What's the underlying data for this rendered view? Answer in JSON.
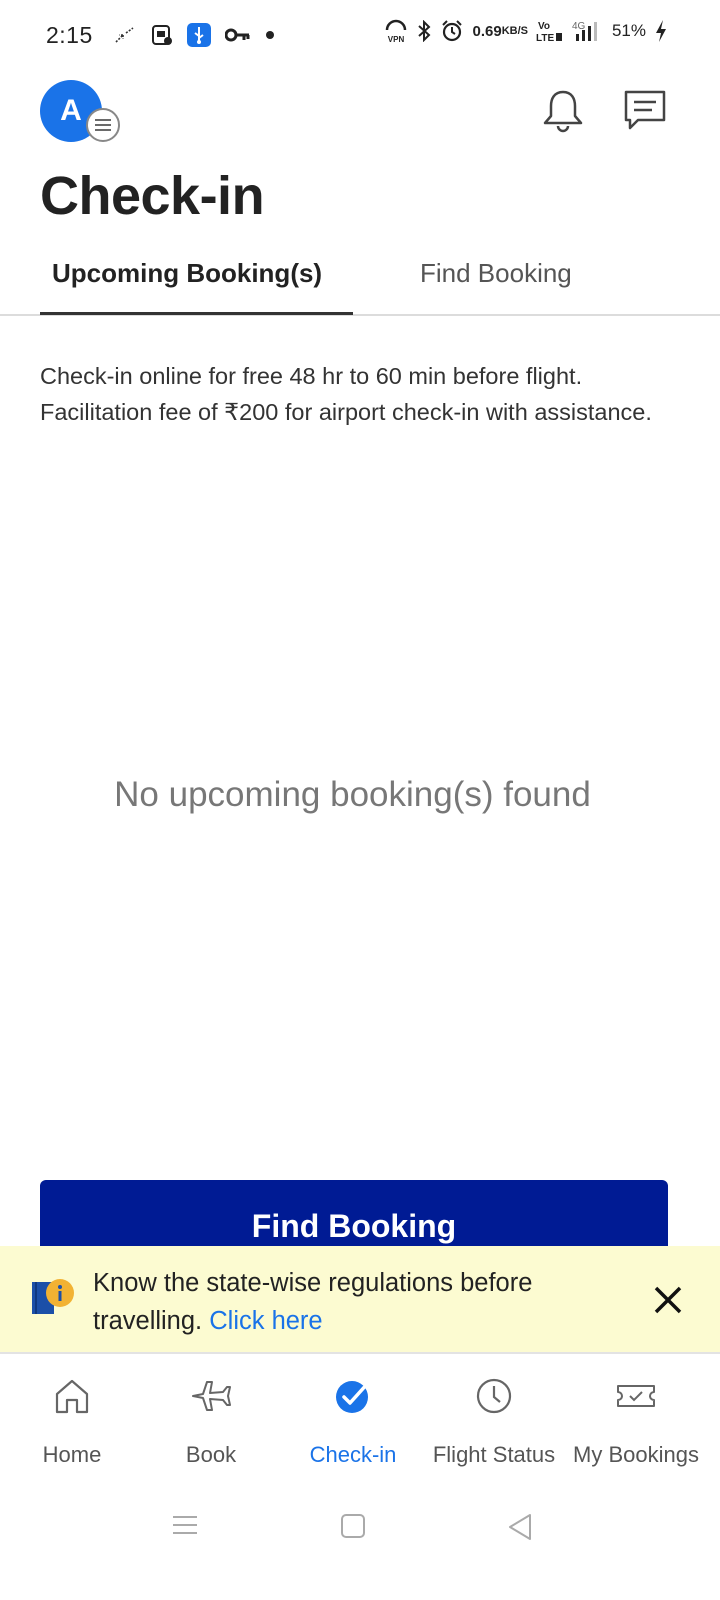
{
  "status_bar": {
    "time": "2:15",
    "net_speed_value": "0.69",
    "net_speed_unit": "KB/S",
    "battery": "51%",
    "icons": [
      "missed-call-icon",
      "sim-icon",
      "usb-icon",
      "key-icon",
      "dot-icon",
      "vpn-icon",
      "bluetooth-icon",
      "alarm-icon",
      "volte-icon",
      "signal-icon",
      "charging-icon"
    ]
  },
  "header": {
    "avatar_letter": "A",
    "title": "Check-in"
  },
  "tabs": [
    {
      "label": "Upcoming Booking(s)",
      "active": true
    },
    {
      "label": "Find Booking",
      "active": false
    }
  ],
  "info_text": "Check-in online for free 48 hr to 60 min before flight. Facilitation fee of ₹200 for airport check-in with assistance.",
  "empty_state": "No upcoming booking(s) found",
  "find_button_label": "Find Booking",
  "banner": {
    "text": "Know the state-wise regulations before travelling.",
    "link": "Click here"
  },
  "bottom_nav": [
    {
      "label": "Home",
      "icon": "home-icon",
      "active": false
    },
    {
      "label": "Book",
      "icon": "plane-icon",
      "active": false
    },
    {
      "label": "Check-in",
      "icon": "check-circle-icon",
      "active": true
    },
    {
      "label": "Flight Status",
      "icon": "clock-icon",
      "active": false
    },
    {
      "label": "My Bookings",
      "icon": "ticket-icon",
      "active": false
    }
  ],
  "colors": {
    "accent": "#1a73e8",
    "button": "#001b94",
    "banner_bg": "#fcfbd1"
  }
}
